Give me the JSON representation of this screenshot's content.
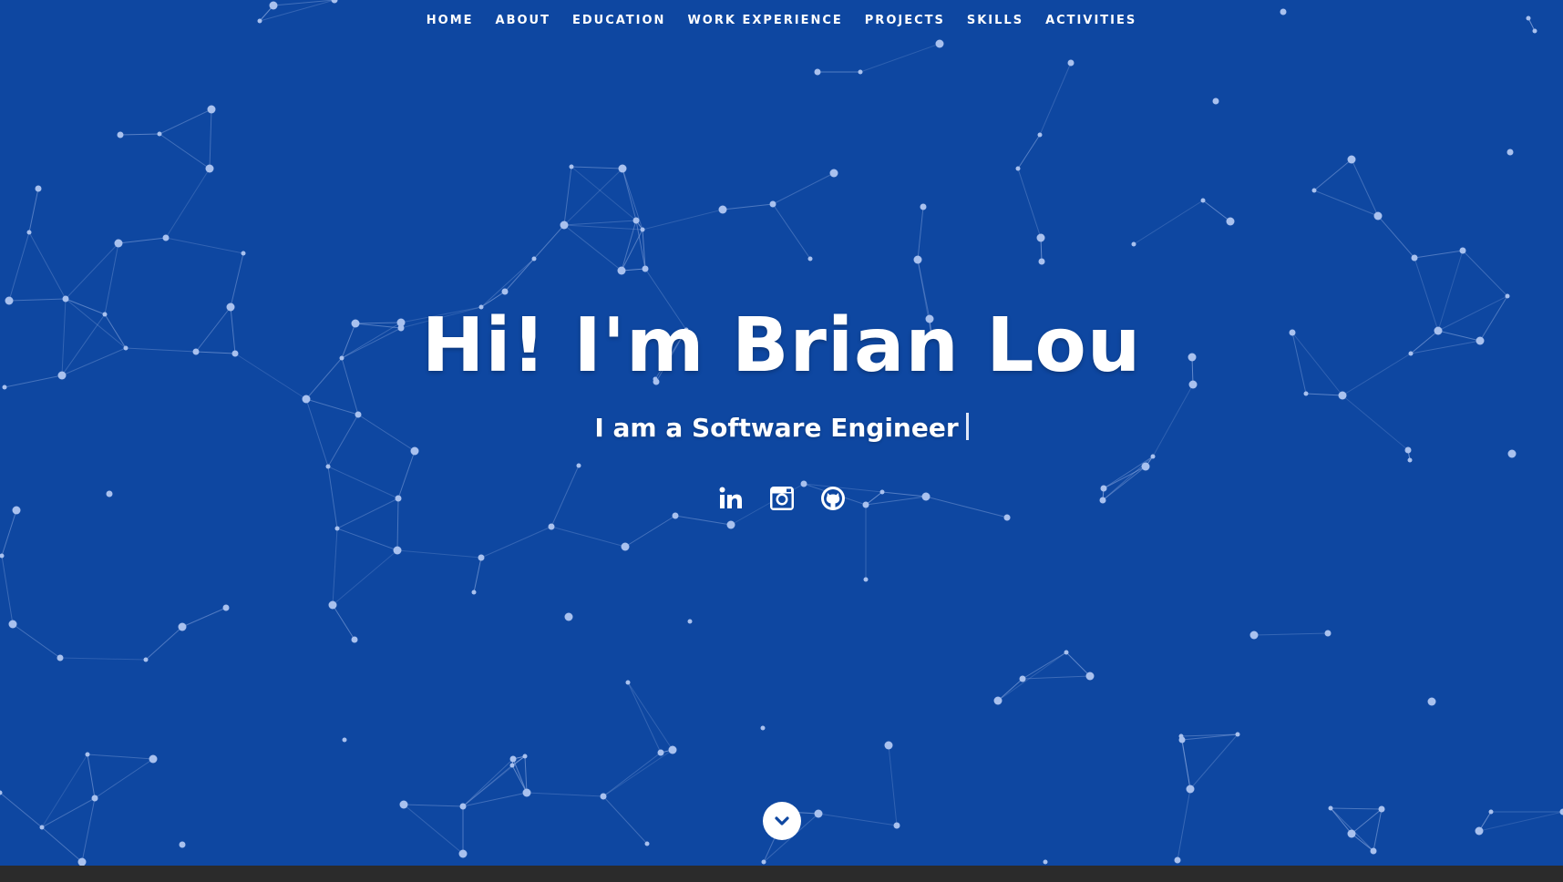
{
  "nav": {
    "items": [
      {
        "label": "HOME",
        "id": "home"
      },
      {
        "label": "ABOUT",
        "id": "about"
      },
      {
        "label": "EDUCATION",
        "id": "education"
      },
      {
        "label": "WORK EXPERIENCE",
        "id": "work-experience"
      },
      {
        "label": "PROJECTS",
        "id": "projects"
      },
      {
        "label": "SKILLS",
        "id": "skills"
      },
      {
        "label": "ACTIVITIES",
        "id": "activities"
      }
    ]
  },
  "hero": {
    "headline": "Hi! I'm Brian Lou",
    "subtitle": "I am a Software Engineer"
  },
  "socials": [
    {
      "name": "linkedin",
      "icon": "linkedin-icon"
    },
    {
      "name": "instagram",
      "icon": "instagram-icon"
    },
    {
      "name": "github",
      "icon": "github-icon"
    }
  ],
  "scroll_icon": "chevron-down-icon",
  "colors": {
    "background": "#0e47a1",
    "network": "#9fb9ea",
    "text": "#ffffff",
    "bottom_bar": "#2b2b2b"
  }
}
